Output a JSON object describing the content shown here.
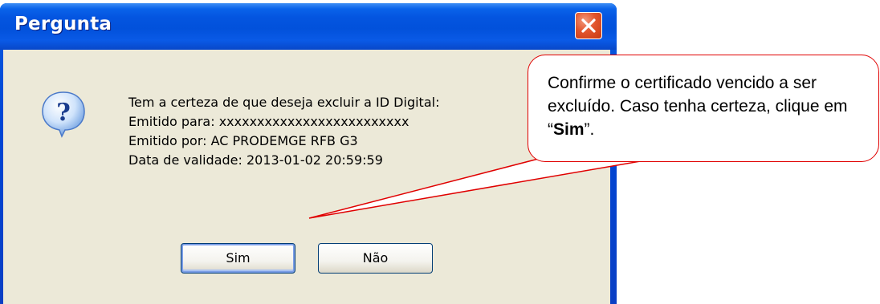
{
  "dialog": {
    "title": "Pergunta",
    "message_lines": [
      "Tem a certeza de que deseja excluir a ID Digital:",
      "Emitido para:  xxxxxxxxxxxxxxxxxxxxxxxxx",
      "Emitido por: AC PRODEMGE RFB G3",
      "Data de validade: 2013-01-02 20:59:59"
    ],
    "buttons": {
      "yes": "Sim",
      "no": "Não"
    },
    "icon": "question-icon"
  },
  "callout": {
    "text_before": "Confirme o certificado vencido a ser excluído. Caso tenha certeza, clique em “",
    "text_bold": "Sim",
    "text_after": "”."
  },
  "colors": {
    "titlebar": "#0455e0",
    "dialog_background": "#ece9d8",
    "close_button": "#e2552d",
    "callout_border": "#e00000"
  }
}
